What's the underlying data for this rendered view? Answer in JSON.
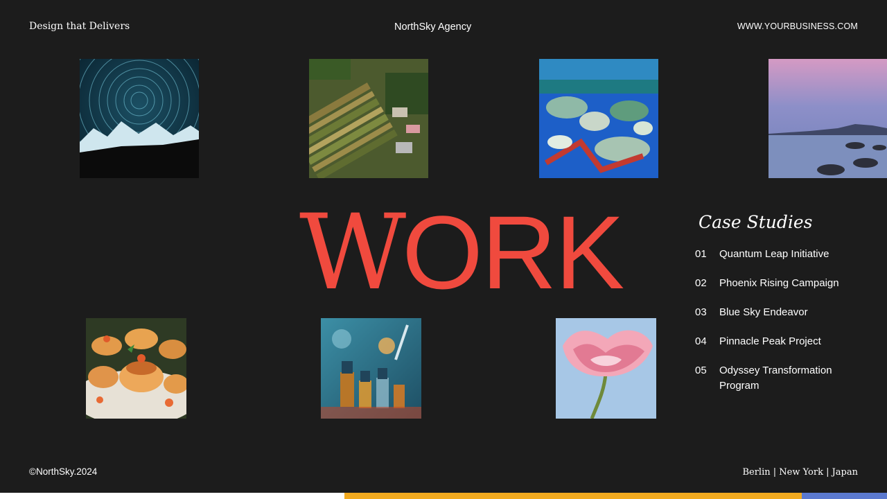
{
  "header": {
    "tagline": "Design that Delivers",
    "brand": "NorthSky Agency",
    "website": "WWW.YOURBUSINESS.COM"
  },
  "hero": {
    "title_first": "W",
    "title_rest": "ORK"
  },
  "case_studies": {
    "title": "Case Studies",
    "items": [
      {
        "num": "01",
        "label": "Quantum Leap Initiative"
      },
      {
        "num": "02",
        "label": "Phoenix Rising Campaign"
      },
      {
        "num": "03",
        "label": "Blue Sky Endeavor"
      },
      {
        "num": "04",
        "label": "Pinnacle Peak Project"
      },
      {
        "num": "05",
        "label": "Odyssey Transformation Program"
      }
    ]
  },
  "footer": {
    "copyright": "©NorthSky.2024",
    "locations": "Berlin | New York | Japan"
  },
  "colors": {
    "background": "#1c1c1c",
    "accent": "#f04a3e",
    "bar_yellow": "#f2aa1f",
    "bar_blue": "#5b79cf"
  }
}
